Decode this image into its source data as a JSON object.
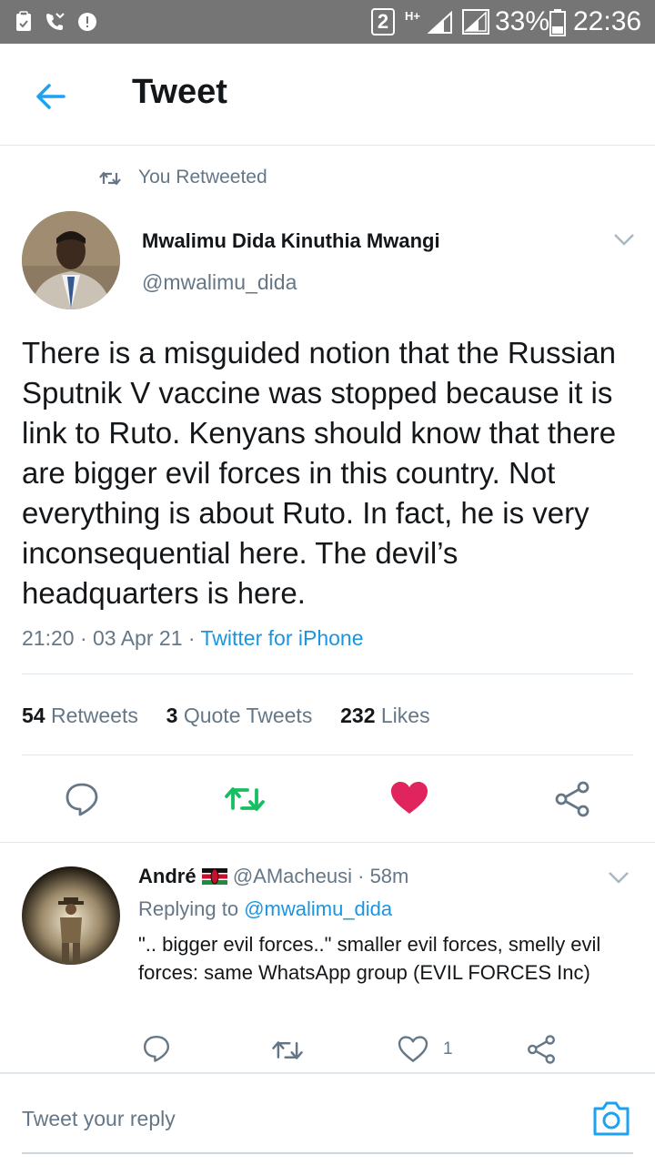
{
  "status_bar": {
    "sim_slot": "2",
    "network_type": "H+",
    "battery_percent": "33%",
    "time": "22:36"
  },
  "header": {
    "title": "Tweet"
  },
  "retweet_context": {
    "label": "You Retweeted"
  },
  "tweet": {
    "author_name": "Mwalimu Dida Kinuthia Mwangi",
    "author_handle": "@mwalimu_dida",
    "text": "There is a misguided notion that the Russian Sputnik V vaccine was stopped because it is link to Ruto. Kenyans should know that there are bigger evil forces in this country. Not everything is about Ruto. In fact, he is very inconsequential here. The devil’s headquarters is here.",
    "time": "21:20",
    "date": "03 Apr 21",
    "dot": "·",
    "source": "Twitter for iPhone",
    "stats": {
      "retweets_count": "54",
      "retweets_label": "Retweets",
      "quotes_count": "3",
      "quotes_label": "Quote Tweets",
      "likes_count": "232",
      "likes_label": "Likes"
    },
    "colors": {
      "retweeted": "#17bf63",
      "liked": "#e0245e"
    }
  },
  "reply": {
    "author_name": "André",
    "author_handle": "@AMacheusi",
    "dot": "·",
    "age": "58m",
    "replying_label": "Replying to",
    "replying_handle": "@mwalimu_dida",
    "text": "\".. bigger evil forces..\" smaller evil forces, smelly evil forces: same WhatsApp group (EVIL FORCES Inc)",
    "like_count": "1"
  },
  "composer": {
    "placeholder": "Tweet your reply"
  },
  "icons": [
    "back-arrow-icon",
    "retweet-icon",
    "chevron-down-icon",
    "reply-icon",
    "heart-icon",
    "share-icon",
    "camera-icon",
    "kenya-flag-icon"
  ]
}
